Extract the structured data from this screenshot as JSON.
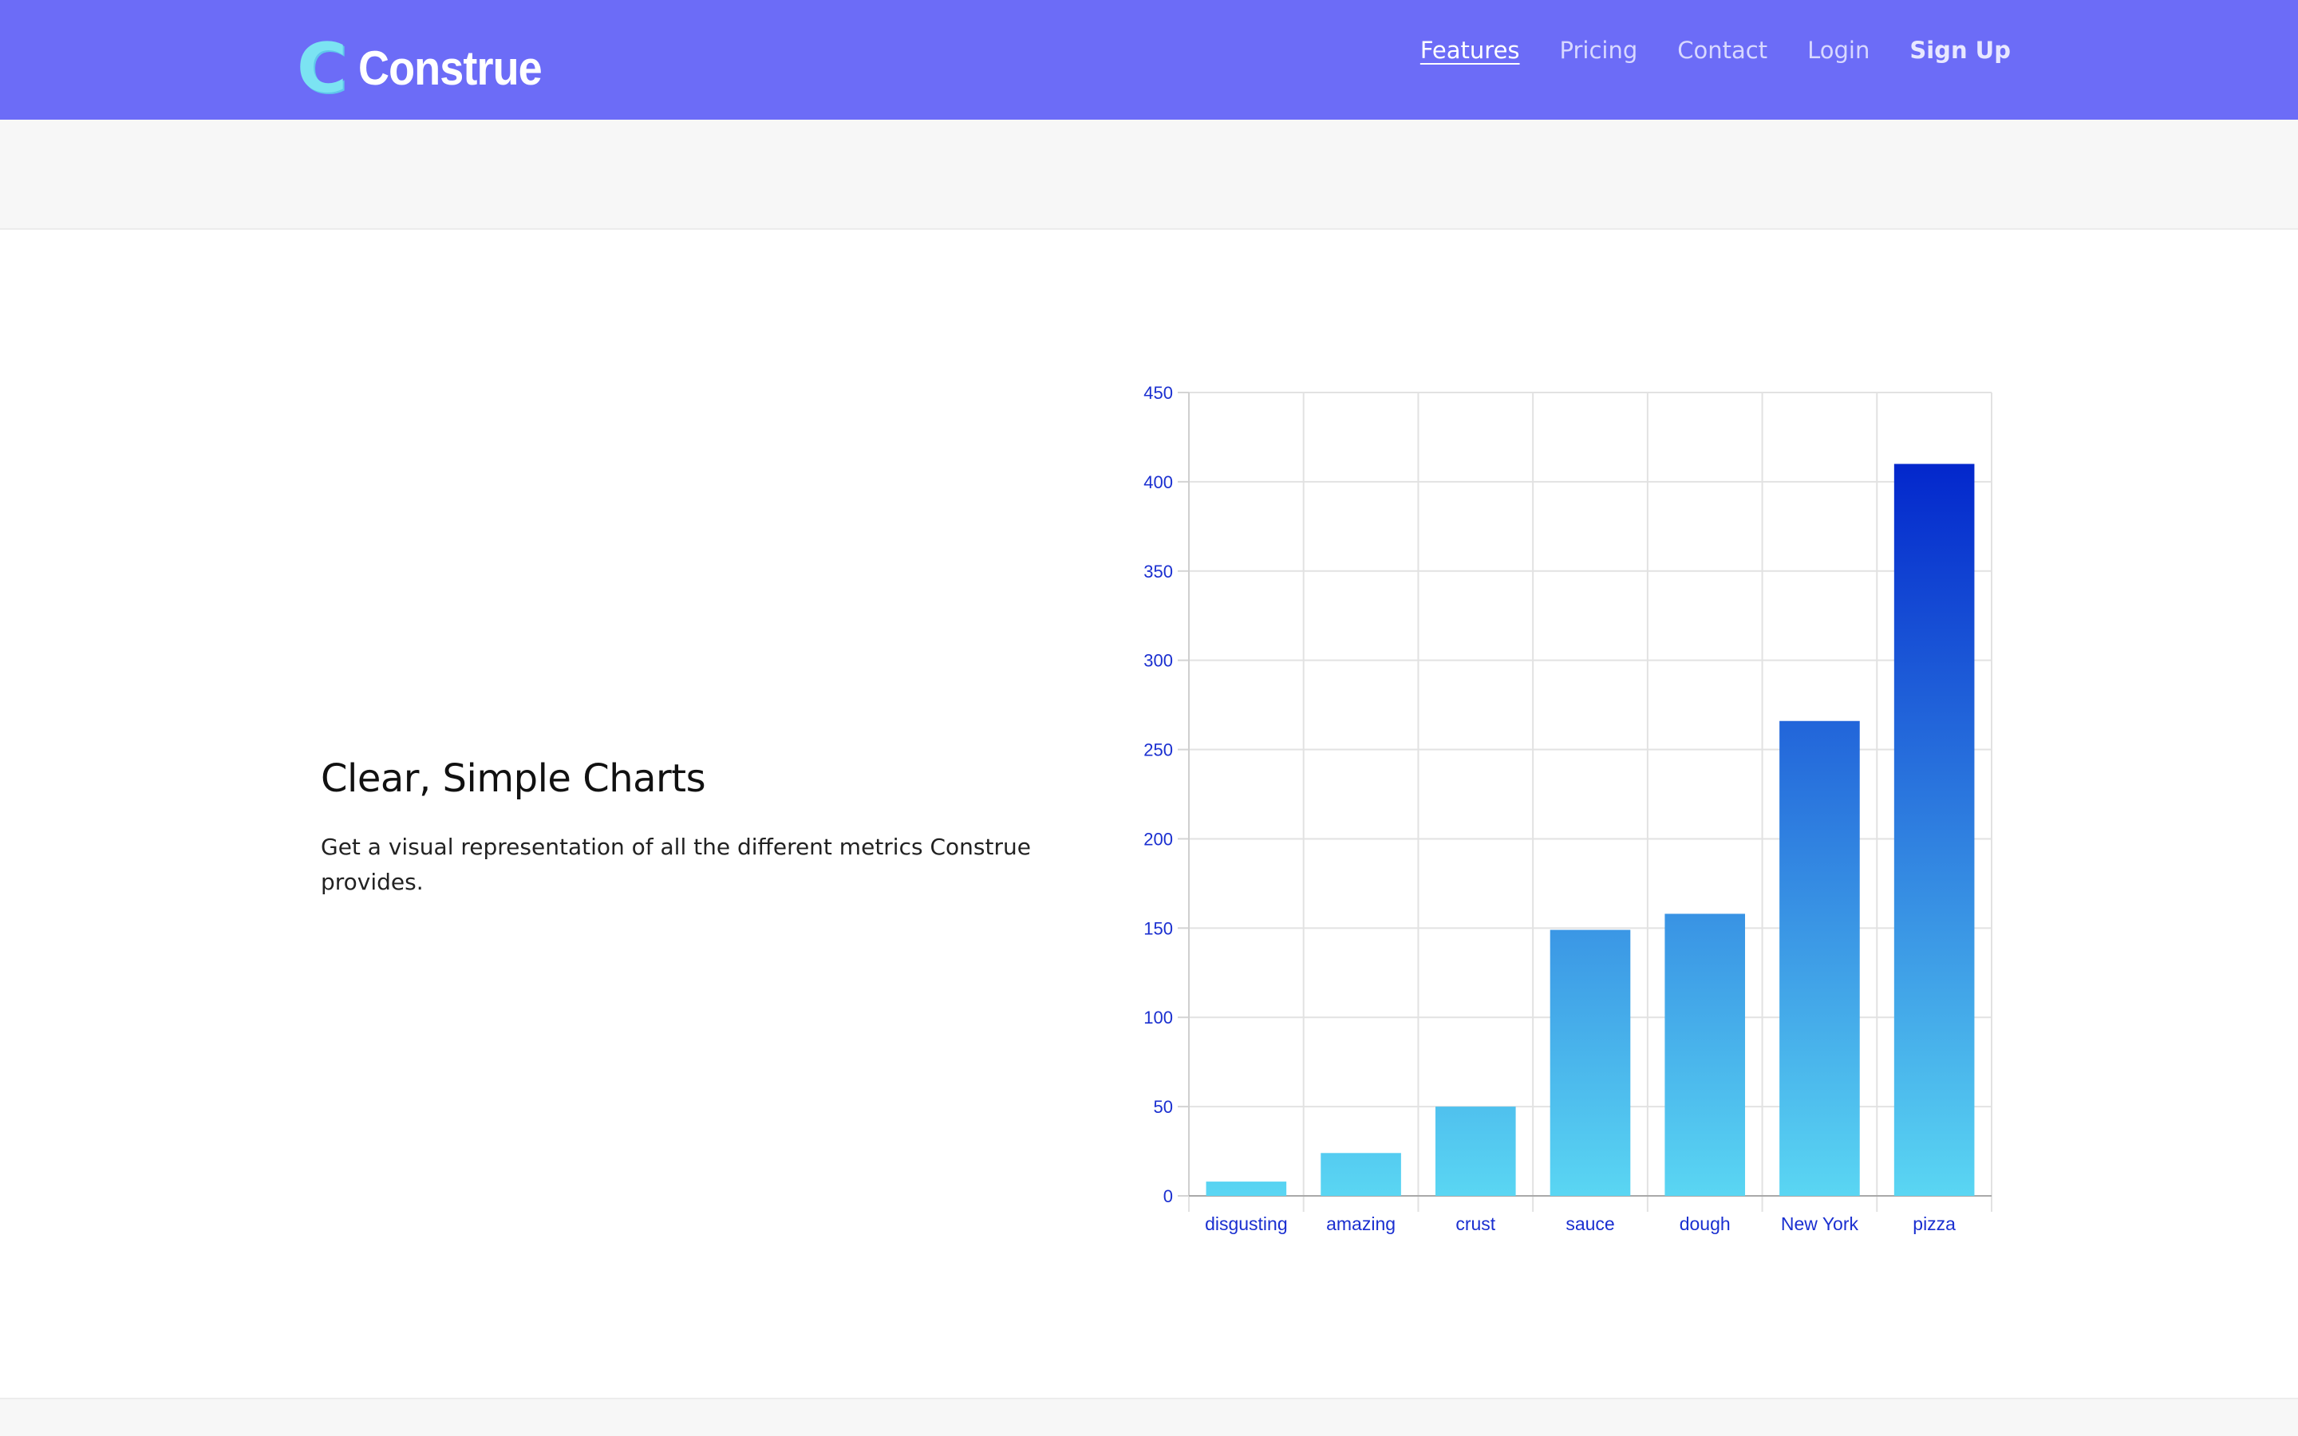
{
  "brand": {
    "logo_mark": "C",
    "name": "Construe"
  },
  "nav": {
    "items": [
      {
        "label": "Features",
        "active": true
      },
      {
        "label": "Pricing"
      },
      {
        "label": "Contact"
      },
      {
        "label": "Login"
      },
      {
        "label": "Sign Up",
        "bold": true
      }
    ]
  },
  "feature": {
    "title": "Clear, Simple Charts",
    "description": "Get a visual representation of all the different metrics Construe provides."
  },
  "colors": {
    "navbar": "#6c6cf7",
    "axis_label": "#1a2fd0",
    "bar_low": "#5ad6f3",
    "bar_high": "#0327cc"
  },
  "chart_data": {
    "type": "bar",
    "categories": [
      "disgusting",
      "amazing",
      "crust",
      "sauce",
      "dough",
      "New York",
      "pizza"
    ],
    "values": [
      8,
      24,
      50,
      149,
      158,
      266,
      410
    ],
    "ylim": [
      0,
      450
    ],
    "yticks": [
      0,
      50,
      100,
      150,
      200,
      250,
      300,
      350,
      400,
      450
    ],
    "grid": true,
    "title": "",
    "xlabel": "",
    "ylabel": ""
  }
}
